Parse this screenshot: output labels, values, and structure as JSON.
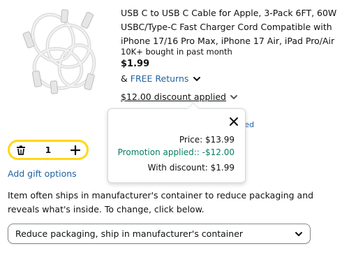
{
  "product": {
    "title": "USB C to USB C Cable for Apple, 3-Pack 6FT, 60W USBC/Type-C Fast Charger Cord Compatible with iPhone 17/16 Pro Max, iPhone 17 Air, iPad Pro/Air",
    "bought": "10K+ bought in past month",
    "price": "$1.99",
    "returns_prefix": "&",
    "returns_link": "FREE Returns",
    "discount_trigger": "$12.00 discount applied",
    "partial_link": "ited",
    "image_icon": "cable-image"
  },
  "discount_popover": {
    "price_line": "Price: $13.99",
    "promotion_line": "Promotion applied:: -$12.00",
    "with_discount_line": "With discount: $1.99",
    "close_icon": "close-icon"
  },
  "quantity": {
    "value": "1",
    "delete_icon": "trash-icon",
    "add_icon": "plus-icon"
  },
  "gift": {
    "label": "Add gift options"
  },
  "packaging": {
    "note": "Item often ships in manufacturer's container to reduce packaging and reveals what's inside. To change, click below.",
    "selected_option": "Reduce packaging, ship in manufacturer's container"
  },
  "colors": {
    "link": "#2162a1",
    "promotion": "#067d62",
    "stepper_border": "#ffd814",
    "text": "#0f1111"
  }
}
